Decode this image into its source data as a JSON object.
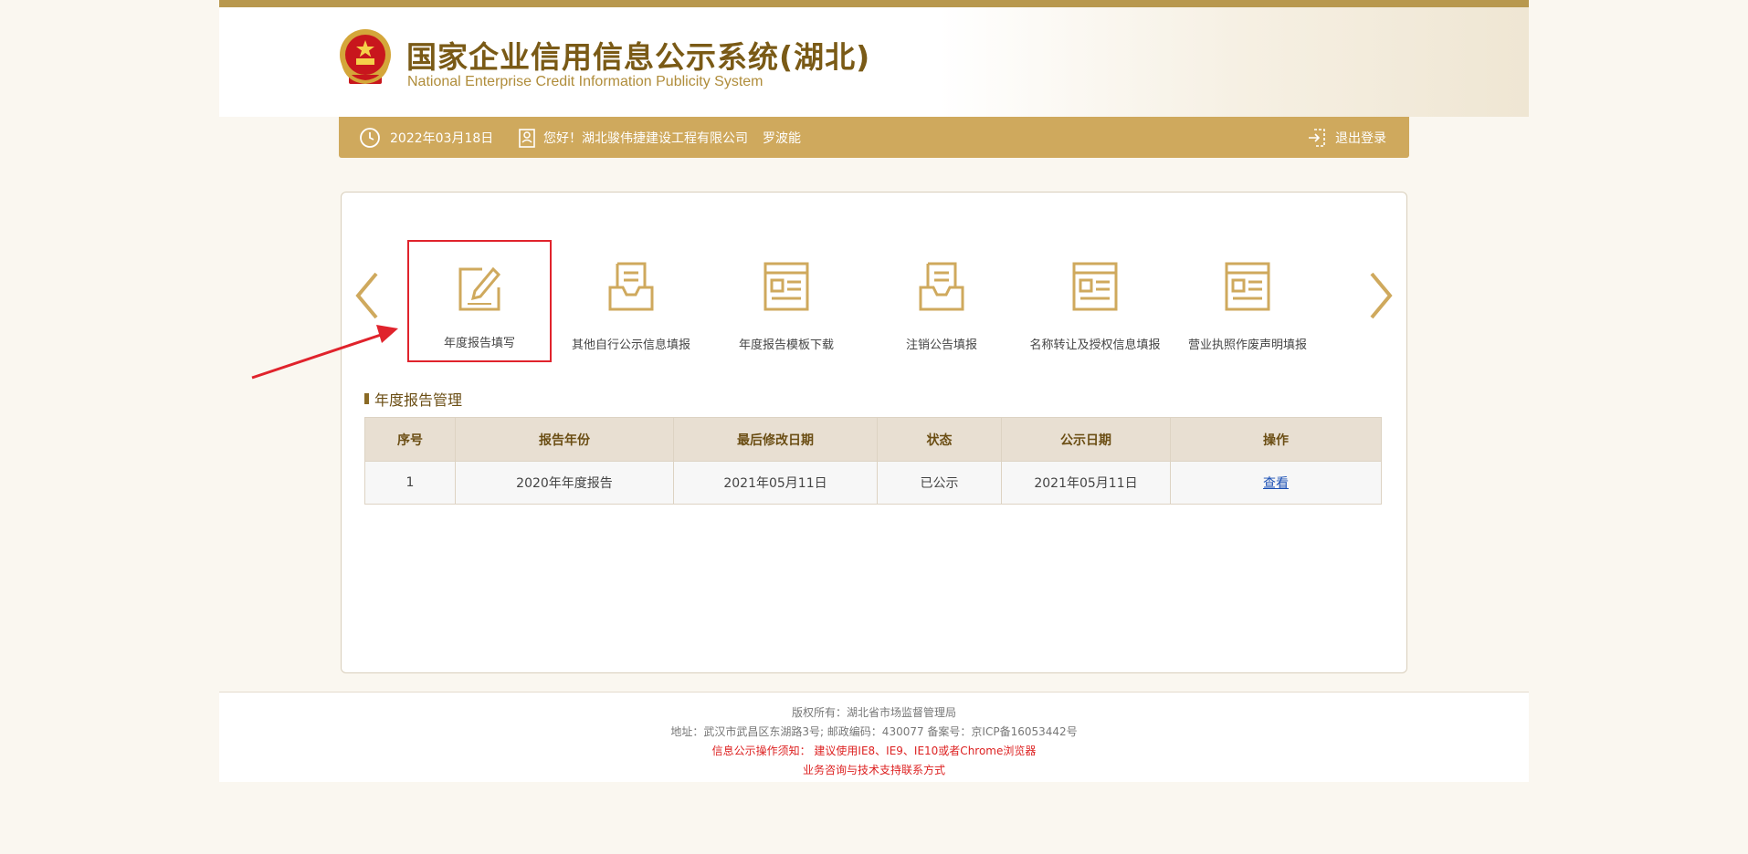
{
  "header": {
    "title_cn": "国家企业信用信息公示系统(湖北)",
    "title_en": "National Enterprise Credit Information Publicity System"
  },
  "infobar": {
    "date": "2022年03月18日",
    "greeting": "您好！湖北骏伟捷建设工程有限公司",
    "user": "罗波能",
    "logout": "退出登录"
  },
  "menu": {
    "items": [
      {
        "label": "年度报告填写",
        "icon": "edit-icon"
      },
      {
        "label": "其他自行公示信息填报",
        "icon": "tray-icon"
      },
      {
        "label": "年度报告模板下载",
        "icon": "document-icon"
      },
      {
        "label": "注销公告填报",
        "icon": "tray-icon"
      },
      {
        "label": "名称转让及授权信息填报",
        "icon": "document-icon"
      },
      {
        "label": "营业执照作废声明填报",
        "icon": "document-icon"
      }
    ]
  },
  "section": {
    "title": "年度报告管理"
  },
  "table": {
    "headers": [
      "序号",
      "报告年份",
      "最后修改日期",
      "状态",
      "公示日期",
      "操作"
    ],
    "rows": [
      {
        "no": "1",
        "year": "2020年年度报告",
        "modified": "2021年05月11日",
        "status": "已公示",
        "published": "2021年05月11日",
        "action": "查看"
      }
    ]
  },
  "footer": {
    "copyright": "版权所有：湖北省市场监督管理局",
    "address": "地址：武汉市武昌区东湖路3号; 邮政编码：430077 备案号：京ICP备16053442号",
    "notice": "信息公示操作须知： 建议使用IE8、IE9、IE10或者Chrome浏览器",
    "support": "业务咨询与技术支持联系方式"
  },
  "colors": {
    "gold": "#cfa95d",
    "brown": "#6b4e14",
    "highlight_red": "#e0232c",
    "link": "#1a4fb5"
  }
}
